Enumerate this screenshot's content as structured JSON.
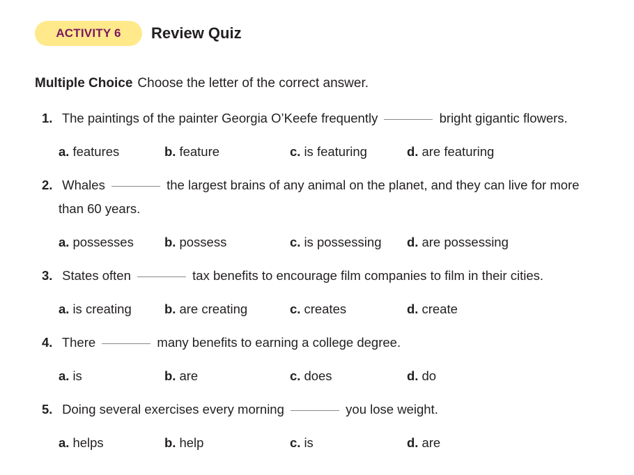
{
  "activity": {
    "badge": "ACTIVITY 6",
    "title": "Review Quiz"
  },
  "directions": {
    "heading": "Multiple Choice",
    "text": "Choose the letter of the correct answer."
  },
  "questions": [
    {
      "num": "1.",
      "before": "The paintings of the painter Georgia O’Keefe frequently",
      "after": "bright gigantic flowers.",
      "cont": "",
      "choices": [
        {
          "letter": "a.",
          "text": "features"
        },
        {
          "letter": "b.",
          "text": "feature"
        },
        {
          "letter": "c.",
          "text": "is featuring"
        },
        {
          "letter": "d.",
          "text": "are featuring"
        }
      ]
    },
    {
      "num": "2.",
      "before": "Whales",
      "after": "the largest brains of any animal on the planet, and they can live for more",
      "cont": "than 60 years.",
      "choices": [
        {
          "letter": "a.",
          "text": "possesses"
        },
        {
          "letter": "b.",
          "text": "possess"
        },
        {
          "letter": "c.",
          "text": "is possessing"
        },
        {
          "letter": "d.",
          "text": "are possessing"
        }
      ]
    },
    {
      "num": "3.",
      "before": "States often",
      "after": "tax benefits to encourage film companies to film in their cities.",
      "cont": "",
      "choices": [
        {
          "letter": "a.",
          "text": "is creating"
        },
        {
          "letter": "b.",
          "text": "are creating"
        },
        {
          "letter": "c.",
          "text": "creates"
        },
        {
          "letter": "d.",
          "text": "create"
        }
      ]
    },
    {
      "num": "4.",
      "before": "There",
      "after": "many benefits to earning a college degree.",
      "cont": "",
      "choices": [
        {
          "letter": "a.",
          "text": "is"
        },
        {
          "letter": "b.",
          "text": "are"
        },
        {
          "letter": "c.",
          "text": "does"
        },
        {
          "letter": "d.",
          "text": "do"
        }
      ]
    },
    {
      "num": "5.",
      "before": "Doing several exercises every morning",
      "after": "you lose weight.",
      "cont": "",
      "choices": [
        {
          "letter": "a.",
          "text": "helps"
        },
        {
          "letter": "b.",
          "text": "help"
        },
        {
          "letter": "c.",
          "text": "is"
        },
        {
          "letter": "d.",
          "text": "are"
        }
      ]
    }
  ]
}
